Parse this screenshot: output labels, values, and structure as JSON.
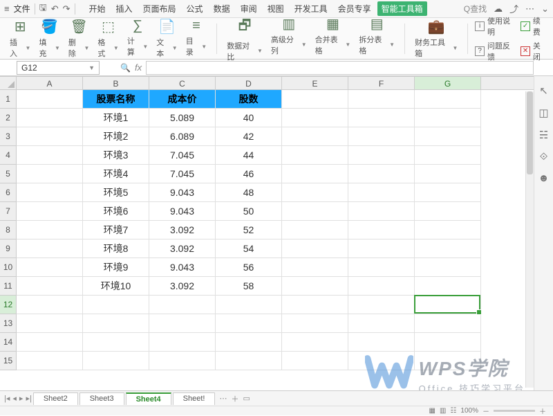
{
  "menubar": {
    "file": "文件",
    "tabs": [
      "开始",
      "插入",
      "页面布局",
      "公式",
      "数据",
      "审阅",
      "视图",
      "开发工具",
      "会员专享",
      "智能工具箱"
    ],
    "activeTab": 9,
    "search": "Q查找"
  },
  "ribbon": {
    "groups": [
      {
        "icon": "⊞",
        "label": "插入"
      },
      {
        "icon": "🪣",
        "label": "填充"
      },
      {
        "icon": "🗑",
        "label": "删除"
      },
      {
        "icon": "⬚",
        "label": "格式"
      },
      {
        "icon": "∑",
        "label": "计算"
      },
      {
        "icon": "📄",
        "label": "文本"
      },
      {
        "icon": "≡",
        "label": "目录"
      }
    ],
    "groups2": [
      {
        "icon": "🗗",
        "label": "数据对比"
      },
      {
        "icon": "▥",
        "label": "高级分列"
      },
      {
        "icon": "▦",
        "label": "合并表格"
      },
      {
        "icon": "▤",
        "label": "拆分表格"
      }
    ],
    "groups3": [
      {
        "icon": "💼",
        "label": "财务工具箱"
      }
    ],
    "right": {
      "usage": "使用说明",
      "feedback": "问题反馈",
      "continue": "续费",
      "close": "关闭"
    }
  },
  "namebox": "G12",
  "fx": "fx",
  "columns": [
    "A",
    "B",
    "C",
    "D",
    "E",
    "F",
    "G"
  ],
  "headerRow": {
    "B": "股票名称",
    "C": "成本价",
    "D": "股数"
  },
  "rows": [
    {
      "n": 1
    },
    {
      "n": 2,
      "B": "环境1",
      "C": "5.089",
      "D": "40"
    },
    {
      "n": 3,
      "B": "环境2",
      "C": "6.089",
      "D": "42"
    },
    {
      "n": 4,
      "B": "环境3",
      "C": "7.045",
      "D": "44"
    },
    {
      "n": 5,
      "B": "环境4",
      "C": "7.045",
      "D": "46"
    },
    {
      "n": 6,
      "B": "环境5",
      "C": "9.043",
      "D": "48"
    },
    {
      "n": 7,
      "B": "环境6",
      "C": "9.043",
      "D": "50"
    },
    {
      "n": 8,
      "B": "环境7",
      "C": "3.092",
      "D": "52"
    },
    {
      "n": 9,
      "B": "环境8",
      "C": "3.092",
      "D": "54"
    },
    {
      "n": 10,
      "B": "环境9",
      "C": "9.043",
      "D": "56"
    },
    {
      "n": 11,
      "B": "环境10",
      "C": "3.092",
      "D": "58"
    },
    {
      "n": 12
    },
    {
      "n": 13
    },
    {
      "n": 14
    },
    {
      "n": 15
    }
  ],
  "selected": {
    "col": "G",
    "row": 12
  },
  "sheets": [
    "Sheet2",
    "Sheet3",
    "Sheet4",
    "Sheet!"
  ],
  "activeSheet": 2,
  "watermark": {
    "brand": "WPS学院",
    "tagline": "Office 技巧学习平台"
  },
  "status": {
    "zoom": "100%"
  }
}
